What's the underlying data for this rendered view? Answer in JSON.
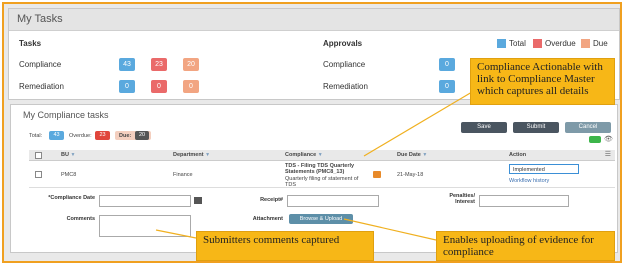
{
  "my_tasks": {
    "title": "My Tasks",
    "tasks_heading": "Tasks",
    "approvals_heading": "Approvals",
    "legend": [
      {
        "label": "Total",
        "color": "#5aa9de"
      },
      {
        "label": "Overdue",
        "color": "#ea6a6a"
      },
      {
        "label": "Due",
        "color": "#f2a582"
      }
    ],
    "tasks_rows": [
      {
        "label": "Compliance",
        "total": "43",
        "overdue": "23",
        "due": "20"
      },
      {
        "label": "Remediation",
        "total": "0",
        "overdue": "0",
        "due": "0"
      }
    ],
    "approvals_rows": [
      {
        "label": "Compliance",
        "total": "0"
      },
      {
        "label": "Remediation",
        "total": "0"
      }
    ]
  },
  "compliance_tasks": {
    "title": "My Compliance tasks",
    "summary": {
      "total_label": "Total:",
      "total_value": "43",
      "overdue_label": "Overdue:",
      "overdue_value": "23",
      "due_label": "Due:",
      "due_value": "20"
    },
    "buttons": {
      "save": "Save",
      "submit": "Submit",
      "cancel": "Cancel"
    },
    "columns": [
      "BU",
      "Department",
      "Compliance",
      "Due Date",
      "Action"
    ],
    "row": {
      "bu": "PMC8",
      "department": "Finance",
      "compliance_title": "TDS - Filing TDS Quarterly Statements (PMC8_13)",
      "compliance_desc": "Quarterly filing of statement of TDS",
      "due_date": "21-May-18",
      "action_select": "Implemented",
      "workflow_link": "Workflow history"
    },
    "form": {
      "compliance_date_label": "*Compliance Date",
      "receipt_label": "Receipt#",
      "penalties_label": "Penalties/ Interest",
      "comments_label": "Comments",
      "attachment_label": "Attachment",
      "browse_button": "Browse & Upload"
    }
  },
  "callouts": {
    "actionable": "Compliance Actionable with link to Compliance Master which captures all details",
    "comments": "Submitters comments captured",
    "uploading": "Enables uploading of evidence for compliance"
  }
}
